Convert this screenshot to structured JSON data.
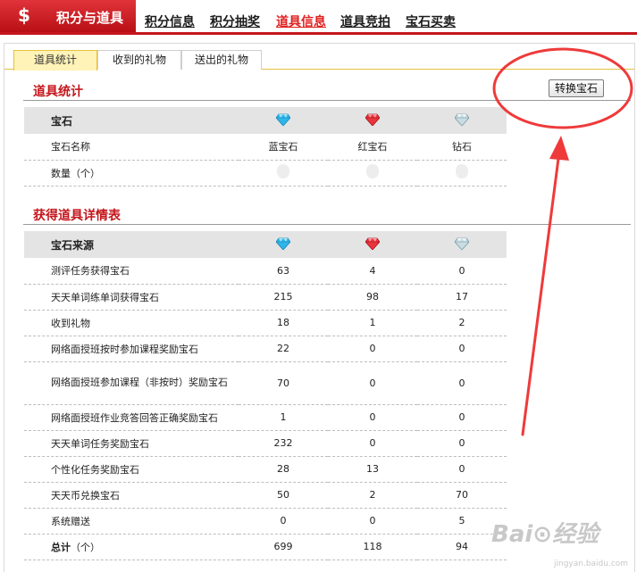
{
  "header": {
    "title": "积分与道具",
    "logo_symbol": "$",
    "nav": [
      {
        "label": "积分信息",
        "active": false
      },
      {
        "label": "积分抽奖",
        "active": false
      },
      {
        "label": "道具信息",
        "active": true
      },
      {
        "label": "道具竞拍",
        "active": false
      },
      {
        "label": "宝石买卖",
        "active": false
      }
    ],
    "accent_color": "#c4161c"
  },
  "tabs": [
    {
      "label": "道具统计",
      "active": true
    },
    {
      "label": "收到的礼物",
      "active": false
    },
    {
      "label": "送出的礼物",
      "active": false
    }
  ],
  "convert_button": "转换宝石",
  "stats": {
    "section_title": "道具统计",
    "header_label": "宝石",
    "row_names_label": "宝石名称",
    "gem_names": [
      "蓝宝石",
      "红宝石",
      "钻石"
    ],
    "count_label": "数量（个）",
    "gem_icons": [
      "blue-gem-icon",
      "red-gem-icon",
      "diamond-icon"
    ]
  },
  "details": {
    "section_title": "获得道具详情表",
    "header_label": "宝石来源",
    "rows": [
      {
        "label": "测评任务获得宝石",
        "values": [
          "63",
          "4",
          "0"
        ]
      },
      {
        "label": "天天单词练单词获得宝石",
        "values": [
          "215",
          "98",
          "17"
        ]
      },
      {
        "label": "收到礼物",
        "values": [
          "18",
          "1",
          "2"
        ]
      },
      {
        "label": "网络面授班按时参加课程奖励宝石",
        "values": [
          "22",
          "0",
          "0"
        ]
      },
      {
        "label": "网络面授班参加课程（非按时）奖励宝石",
        "values": [
          "70",
          "0",
          "0"
        ]
      },
      {
        "label": "网络面授班作业竞答回答正确奖励宝石",
        "values": [
          "1",
          "0",
          "0"
        ]
      },
      {
        "label": "天天单词任务奖励宝石",
        "values": [
          "232",
          "0",
          "0"
        ]
      },
      {
        "label": "个性化任务奖励宝石",
        "values": [
          "28",
          "13",
          "0"
        ]
      },
      {
        "label": "天天币兑换宝石",
        "values": [
          "50",
          "2",
          "70"
        ]
      },
      {
        "label": "系统赠送",
        "values": [
          "0",
          "0",
          "5"
        ]
      }
    ],
    "total": {
      "label_bold": "总计",
      "label_rest": "（个）",
      "values": [
        "699",
        "118",
        "94"
      ]
    }
  },
  "watermark": {
    "brand": "Bai",
    "brand2": "经验",
    "url": "jingyan.baidu.com"
  }
}
